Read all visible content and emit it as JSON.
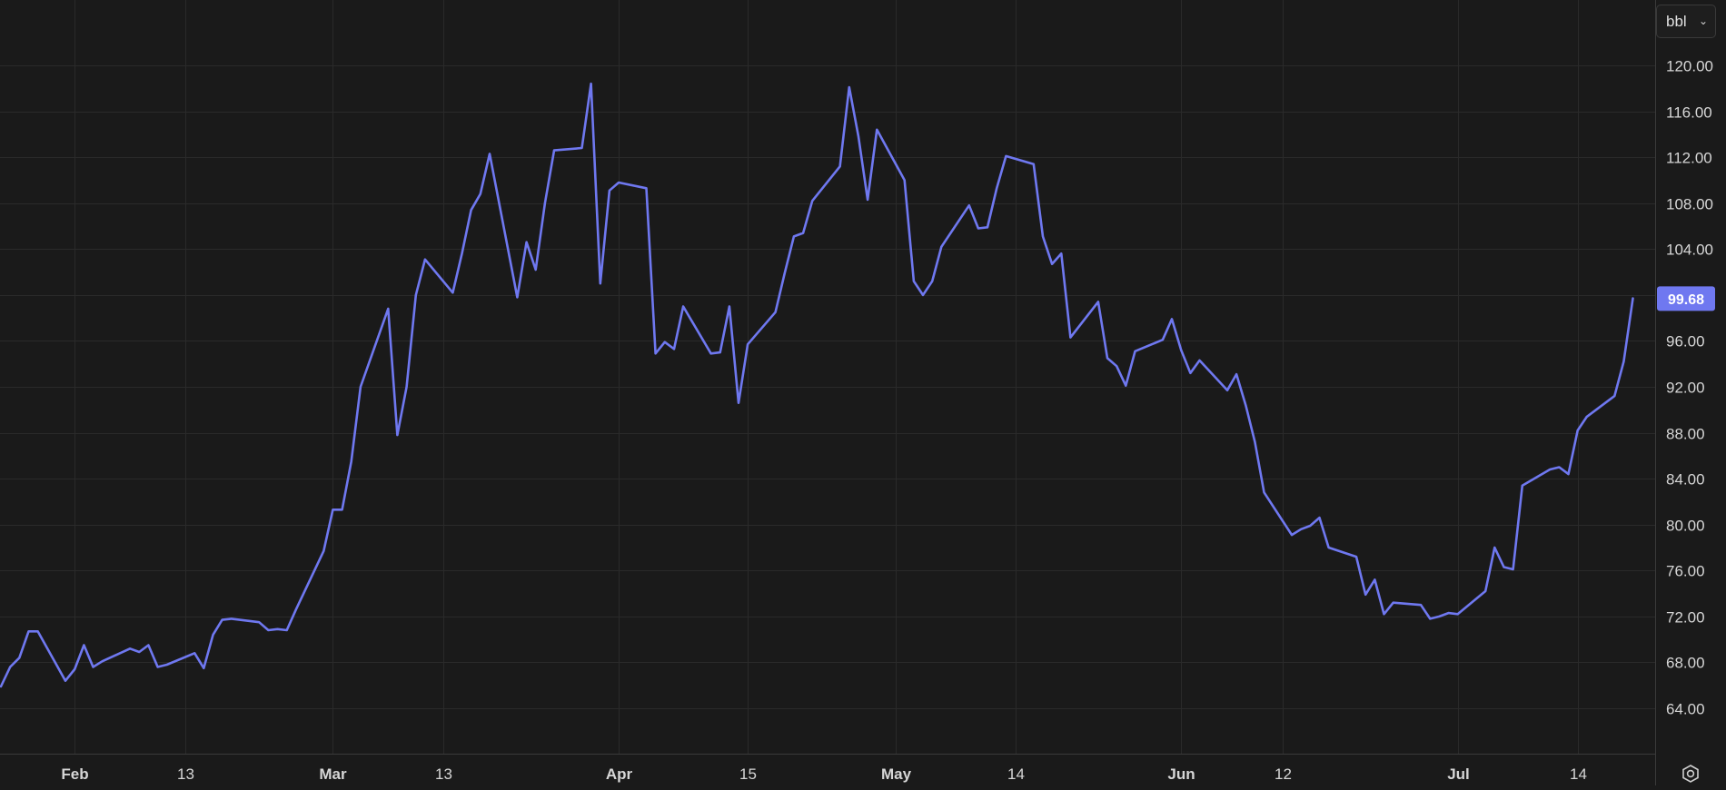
{
  "unit_selector": {
    "value": "bbl"
  },
  "current_price": {
    "label": "99.68",
    "value": 99.68
  },
  "settings": {
    "icon": "gear-icon"
  },
  "colors": {
    "background": "#1a1a1a",
    "grid": "#2a2a2a",
    "line": "#6f78f0",
    "price_badge": "#6f78f0",
    "axis_text": "#d6d6d6"
  },
  "chart_data": {
    "type": "line",
    "title": "",
    "xlabel": "",
    "ylabel": "",
    "ylim": [
      59.5,
      123.0
    ],
    "grid": true,
    "y_ticks": [
      "120.00",
      "116.00",
      "112.00",
      "108.00",
      "104.00",
      "100.00",
      "96.00",
      "92.00",
      "88.00",
      "84.00",
      "80.00",
      "76.00",
      "72.00",
      "68.00",
      "64.00"
    ],
    "x_ticks": [
      "Feb",
      "13",
      "Mar",
      "13",
      "Apr",
      "15",
      "May",
      "14",
      "Jun",
      "12",
      "Jul",
      "14"
    ],
    "x_dates": [
      "2022-01-24",
      "2022-01-25",
      "2022-01-26",
      "2022-01-27",
      "2022-01-28",
      "2022-01-31",
      "2022-02-01",
      "2022-02-02",
      "2022-02-03",
      "2022-02-04",
      "2022-02-07",
      "2022-02-08",
      "2022-02-09",
      "2022-02-10",
      "2022-02-11",
      "2022-02-14",
      "2022-02-15",
      "2022-02-16",
      "2022-02-17",
      "2022-02-18",
      "2022-02-21",
      "2022-02-22",
      "2022-02-23",
      "2022-02-24",
      "2022-02-25",
      "2022-02-28",
      "2022-03-01",
      "2022-03-02",
      "2022-03-03",
      "2022-03-04",
      "2022-03-07",
      "2022-03-08",
      "2022-03-09",
      "2022-03-10",
      "2022-03-11",
      "2022-03-14",
      "2022-03-15",
      "2022-03-16",
      "2022-03-17",
      "2022-03-18",
      "2022-03-21",
      "2022-03-22",
      "2022-03-23",
      "2022-03-24",
      "2022-03-25",
      "2022-03-28",
      "2022-03-29",
      "2022-03-30",
      "2022-03-31",
      "2022-04-01",
      "2022-04-04",
      "2022-04-05",
      "2022-04-06",
      "2022-04-07",
      "2022-04-08",
      "2022-04-11",
      "2022-04-12",
      "2022-04-13",
      "2022-04-14",
      "2022-04-15",
      "2022-04-18",
      "2022-04-19",
      "2022-04-20",
      "2022-04-21",
      "2022-04-22",
      "2022-04-25",
      "2022-04-26",
      "2022-04-27",
      "2022-04-28",
      "2022-04-29",
      "2022-05-02",
      "2022-05-03",
      "2022-05-04",
      "2022-05-05",
      "2022-05-06",
      "2022-05-09",
      "2022-05-10",
      "2022-05-11",
      "2022-05-12",
      "2022-05-13",
      "2022-05-16",
      "2022-05-17",
      "2022-05-18",
      "2022-05-19",
      "2022-05-20",
      "2022-05-23",
      "2022-05-24",
      "2022-05-25",
      "2022-05-26",
      "2022-05-27",
      "2022-05-30",
      "2022-05-31",
      "2022-06-01",
      "2022-06-02",
      "2022-06-03",
      "2022-06-06",
      "2022-06-07",
      "2022-06-08",
      "2022-06-09",
      "2022-06-10",
      "2022-06-13",
      "2022-06-14",
      "2022-06-15",
      "2022-06-16",
      "2022-06-17",
      "2022-06-20",
      "2022-06-21",
      "2022-06-22",
      "2022-06-23",
      "2022-06-24",
      "2022-06-27",
      "2022-06-28",
      "2022-06-29",
      "2022-06-30",
      "2022-07-01",
      "2022-07-04",
      "2022-07-05",
      "2022-07-06",
      "2022-07-07",
      "2022-07-08",
      "2022-07-11",
      "2022-07-12",
      "2022-07-13",
      "2022-07-14",
      "2022-07-15",
      "2022-07-18",
      "2022-07-19",
      "2022-07-20",
      "2022-07-21"
    ],
    "series": [
      {
        "values": [
          65.9,
          67.6,
          68.4,
          70.7,
          70.7,
          66.4,
          67.4,
          69.5,
          67.6,
          68.1,
          69.2,
          68.9,
          69.5,
          67.6,
          67.8,
          68.8,
          67.5,
          70.4,
          71.7,
          71.8,
          71.5,
          70.8,
          70.9,
          70.8,
          72.6,
          77.7,
          81.3,
          81.3,
          85.5,
          92.0,
          98.8,
          87.8,
          92.0,
          100.0,
          103.1,
          100.2,
          103.6,
          107.4,
          108.8,
          112.3,
          99.8,
          104.6,
          102.2,
          108.0,
          112.6,
          112.8,
          118.4,
          101.0,
          109.1,
          109.8,
          109.3,
          94.9,
          95.9,
          95.3,
          99.0,
          94.9,
          95.0,
          99.0,
          90.6,
          95.7,
          98.5,
          101.9,
          105.1,
          105.4,
          108.2,
          111.2,
          118.1,
          113.8,
          108.3,
          114.4,
          110.0,
          101.2,
          100.0,
          101.2,
          104.2,
          107.8,
          105.8,
          105.9,
          109.3,
          112.1,
          111.4,
          105.1,
          102.7,
          103.6,
          96.3,
          99.4,
          94.5,
          93.8,
          92.1,
          95.1,
          96.1,
          97.9,
          95.2,
          93.2,
          94.3,
          91.7,
          93.1,
          90.4,
          87.2,
          82.8,
          79.1,
          79.6,
          79.9,
          80.6,
          78.0,
          77.2,
          73.9,
          75.2,
          72.2,
          73.2,
          73.0,
          71.8,
          72.0,
          72.3,
          72.2,
          74.2,
          78.0,
          76.3,
          76.1,
          83.4,
          84.8,
          85.0,
          84.4,
          88.2,
          89.4,
          91.2,
          94.2,
          99.7
        ]
      }
    ]
  }
}
